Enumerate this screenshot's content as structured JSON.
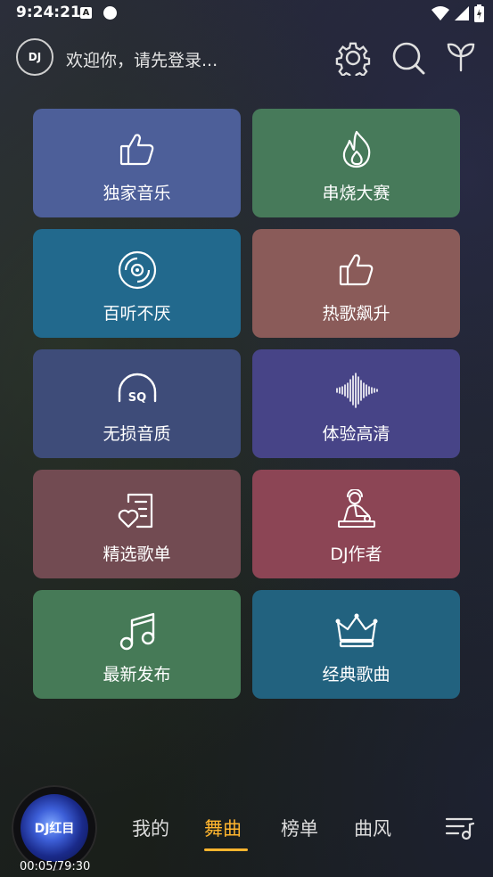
{
  "status": {
    "time": "9:24:21",
    "a_icon": "A"
  },
  "header": {
    "avatar_text": "DJ",
    "welcome": "欢迎你，请先登录..."
  },
  "tiles": [
    {
      "label": "独家音乐",
      "icon": "thumbs-up-icon",
      "color": "#4d5f99"
    },
    {
      "label": "串烧大赛",
      "icon": "flame-icon",
      "color": "#477a5a"
    },
    {
      "label": "百听不厌",
      "icon": "disc-icon",
      "color": "#22698d"
    },
    {
      "label": "热歌飙升",
      "icon": "thumbs-up-icon",
      "color": "#8a5b59"
    },
    {
      "label": "无损音质",
      "icon": "sq-headphones-icon",
      "color": "#3e4c79"
    },
    {
      "label": "体验高清",
      "icon": "waveform-icon",
      "color": "#474487"
    },
    {
      "label": "精选歌单",
      "icon": "playlist-heart-icon",
      "color": "#724b52"
    },
    {
      "label": "DJ作者",
      "icon": "dj-person-icon",
      "color": "#8c4555"
    },
    {
      "label": "最新发布",
      "icon": "music-note-icon",
      "color": "#467a57"
    },
    {
      "label": "经典歌曲",
      "icon": "crown-icon",
      "color": "#22627f"
    }
  ],
  "player": {
    "disc_text": "DJ红目",
    "time": "00:05/79:30"
  },
  "nav": {
    "items": [
      "我的",
      "舞曲",
      "榜单",
      "曲风"
    ],
    "active": "舞曲"
  }
}
